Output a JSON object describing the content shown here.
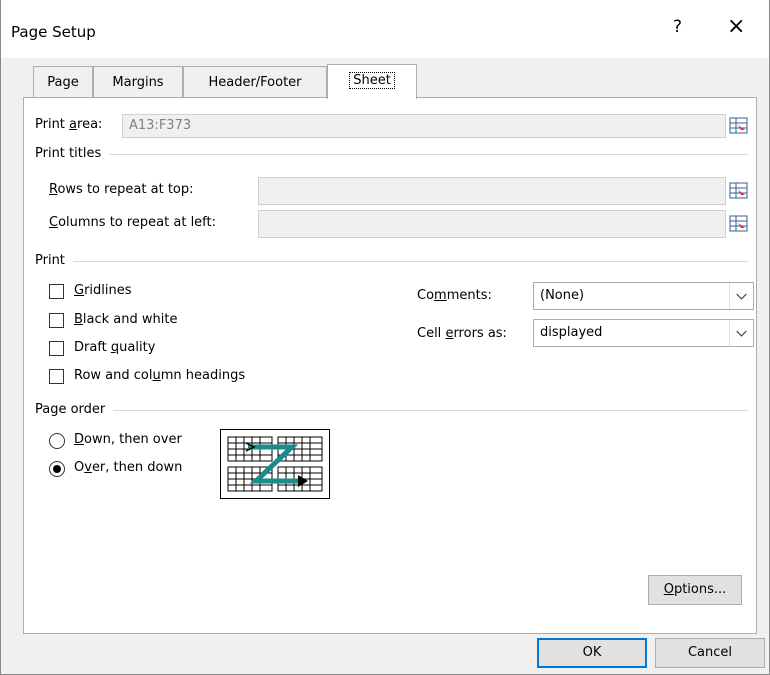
{
  "window": {
    "title": "Page Setup",
    "help_label": "?",
    "close_label": "×"
  },
  "tabs": [
    {
      "label": "Page"
    },
    {
      "label": "Margins"
    },
    {
      "label": "Header/Footer"
    },
    {
      "label": "Sheet",
      "active": true
    }
  ],
  "print_area": {
    "label_pre": "Print ",
    "label_key": "a",
    "label_post": "rea:",
    "value": "A13:F373"
  },
  "print_titles": {
    "heading": "Print titles",
    "rows": {
      "key": "R",
      "label_post": "ows to repeat at top:",
      "value": ""
    },
    "columns": {
      "key": "C",
      "label_post": "olumns to repeat at left:",
      "value": ""
    }
  },
  "print": {
    "heading": "Print",
    "gridlines": {
      "key": "G",
      "post": "ridlines",
      "checked": false
    },
    "black_white": {
      "key": "B",
      "post": "lack and white",
      "checked": false
    },
    "draft": {
      "pre": "Draft ",
      "key": "q",
      "post": "uality",
      "checked": false
    },
    "headings": {
      "pre": "Row and col",
      "key": "u",
      "post": "mn headings",
      "checked": false
    },
    "comments": {
      "pre": "Co",
      "key": "m",
      "post": "ments:",
      "value": "(None)"
    },
    "cell_errors": {
      "pre": "Cell ",
      "key": "e",
      "post": "rrors as:",
      "value": "displayed"
    }
  },
  "page_order": {
    "heading": "Page order",
    "down_over": {
      "key": "D",
      "post": "own, then over",
      "selected": false
    },
    "over_down": {
      "pre": "O",
      "key": "v",
      "post": "er, then down",
      "selected": true
    }
  },
  "buttons": {
    "options": {
      "key": "O",
      "post": "ptions..."
    },
    "ok": "OK",
    "cancel": "Cancel"
  },
  "colors": {
    "accent": "#0078d7",
    "preview_arrow": "#1a8a8a"
  }
}
